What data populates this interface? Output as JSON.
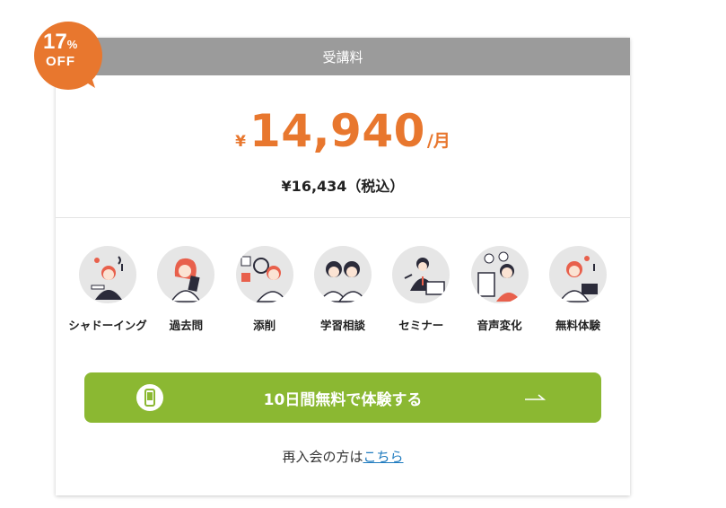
{
  "badge": {
    "number": "17",
    "percent": "%",
    "off": "OFF",
    "color": "#e8772e"
  },
  "card": {
    "header": "受講料",
    "price": {
      "yen": "¥",
      "amount": "14,940",
      "unit": "/月",
      "color": "#e8772e"
    },
    "tax_included": "¥16,434（税込）"
  },
  "features": [
    {
      "label": "シャドーイング",
      "icon": "shadowing-illustration"
    },
    {
      "label": "過去問",
      "icon": "past-exams-illustration"
    },
    {
      "label": "添削",
      "icon": "correction-illustration"
    },
    {
      "label": "学習相談",
      "icon": "study-consultation-illustration"
    },
    {
      "label": "セミナー",
      "icon": "seminar-illustration"
    },
    {
      "label": "音声変化",
      "icon": "sound-change-illustration"
    },
    {
      "label": "無料体験",
      "icon": "free-trial-illustration"
    }
  ],
  "cta": {
    "label": "10日間無料で体験する",
    "color": "#8bb832",
    "icon": "smartphone-icon",
    "arrow": "arrow-right-icon"
  },
  "rejoin": {
    "prefix": "再入会の方は",
    "link": "こちら",
    "link_color": "#1f7bbf"
  }
}
